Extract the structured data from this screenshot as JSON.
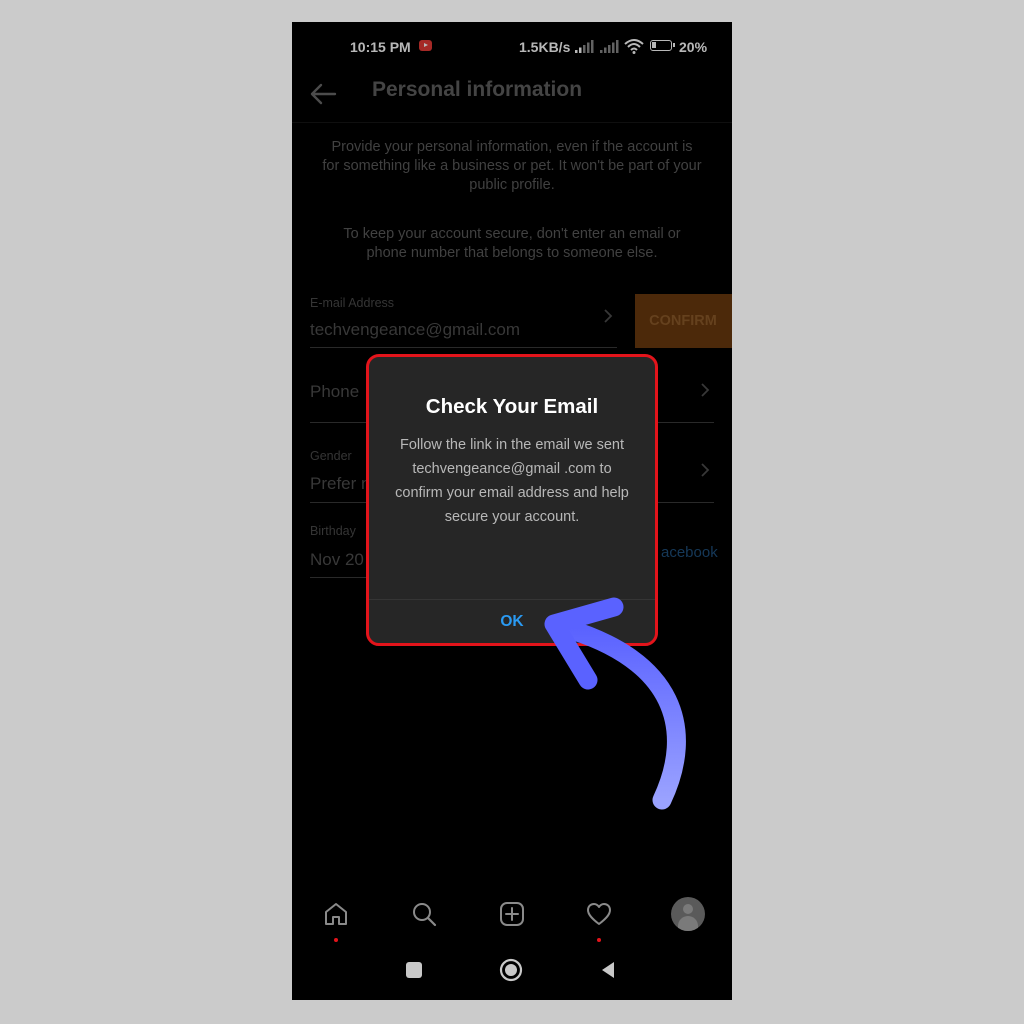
{
  "status_bar": {
    "time": "10:15 PM",
    "network_speed": "1.5KB/s",
    "battery_percent": "20%"
  },
  "app_bar": {
    "title": "Personal information"
  },
  "descriptions": {
    "intro": "Provide your personal information, even if the account is for something like a business or pet. It won't be part of your public profile.",
    "security": "To keep your account secure, don't enter an email or phone number that belongs to someone else."
  },
  "fields": {
    "email_label": "E-mail Address",
    "email_value": "techvengeance@gmail.com",
    "confirm_label": "CONFIRM",
    "phone_label": "Phone",
    "gender_label": "Gender",
    "gender_value": "Prefer n",
    "birthday_label": "Birthday",
    "birthday_value": "Nov 20",
    "facebook_link": "acebook"
  },
  "dialog": {
    "title": "Check Your Email",
    "body": "Follow the link in the email we sent techvengeance@gmail .com to confirm your email address and help secure your account.",
    "ok_label": "OK"
  },
  "colors": {
    "dialog_border": "#e3141b",
    "ok_text": "#2a9af2",
    "confirm_bg": "#6a3a0e",
    "arrow": "#7b86ff"
  },
  "icons": {
    "back": "arrow-left-icon",
    "chevron": "chevron-right-icon",
    "nav": [
      "home-icon",
      "search-icon",
      "add-post-icon",
      "heart-icon",
      "profile-avatar-icon"
    ],
    "system": [
      "recents-icon",
      "home-circle-icon",
      "back-triangle-icon"
    ]
  }
}
